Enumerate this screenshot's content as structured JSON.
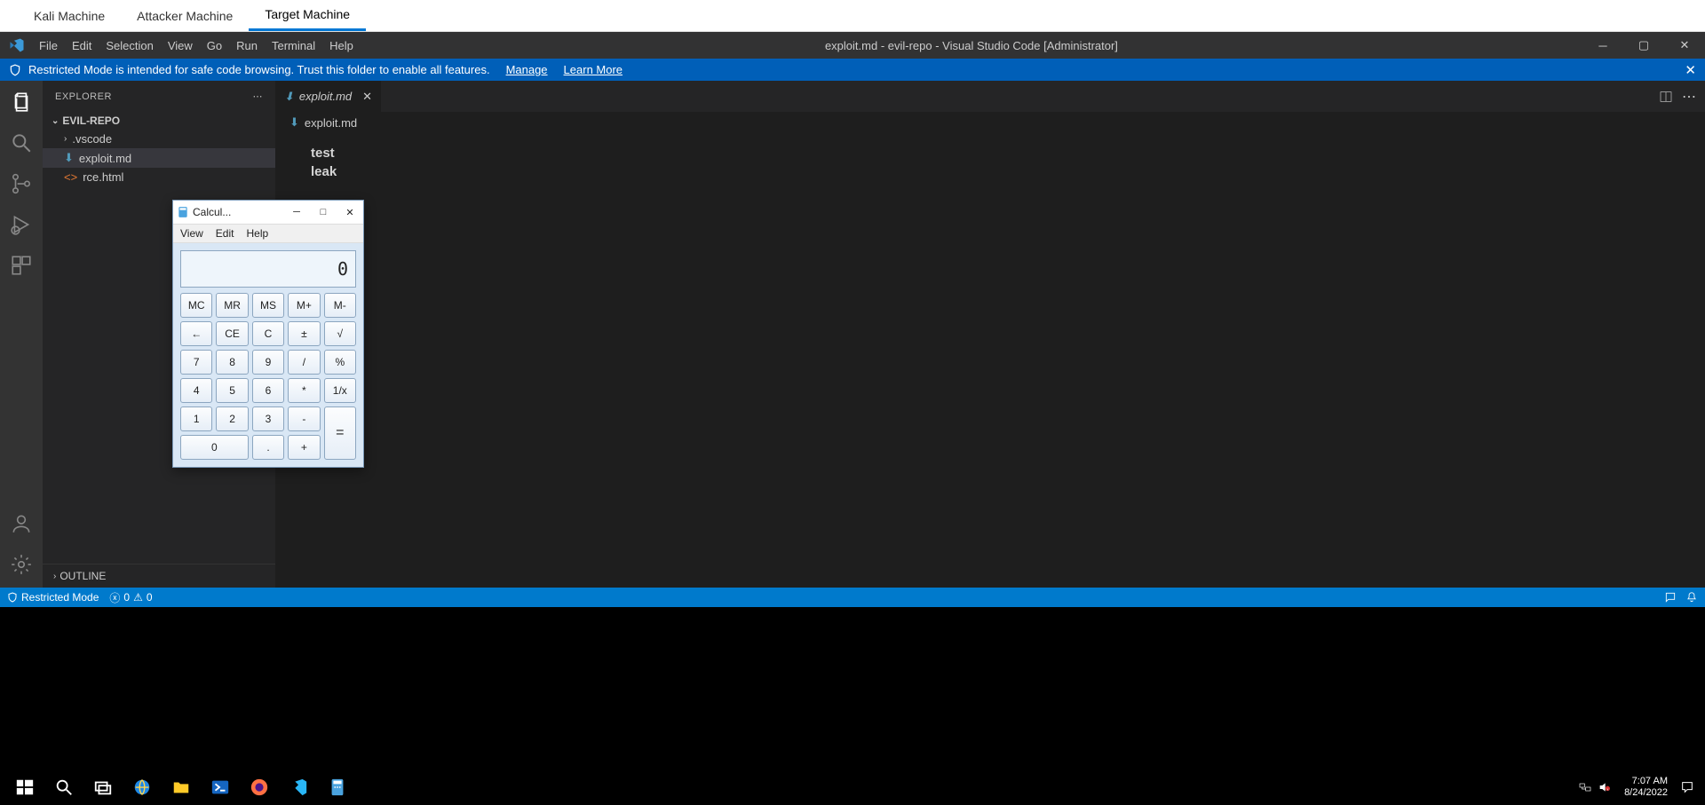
{
  "lab_tabs": {
    "items": [
      "Kali Machine",
      "Attacker Machine",
      "Target Machine"
    ],
    "active_index": 2
  },
  "vscode": {
    "menu": [
      "File",
      "Edit",
      "Selection",
      "View",
      "Go",
      "Run",
      "Terminal",
      "Help"
    ],
    "window_title": "exploit.md - evil-repo - Visual Studio Code [Administrator]",
    "banner": {
      "text": "Restricted Mode is intended for safe code browsing. Trust this folder to enable all features.",
      "manage": "Manage",
      "learn_more": "Learn More"
    },
    "explorer": {
      "title": "EXPLORER",
      "folder": "EVIL-REPO",
      "items": [
        {
          "name": ".vscode",
          "icon": "folder",
          "expanded": false
        },
        {
          "name": "exploit.md",
          "icon": "md",
          "selected": true
        },
        {
          "name": "rce.html",
          "icon": "html"
        }
      ],
      "outline": "OUTLINE"
    },
    "editor": {
      "tab_name": "exploit.md",
      "breadcrumb": "exploit.md",
      "lines": [
        "test",
        "leak"
      ]
    },
    "status": {
      "restricted": "Restricted Mode",
      "errors": "0",
      "warnings": "0"
    }
  },
  "calc": {
    "title": "Calcul...",
    "menu": [
      "View",
      "Edit",
      "Help"
    ],
    "display": "0",
    "rows": {
      "mem": [
        "MC",
        "MR",
        "MS",
        "M+",
        "M-"
      ],
      "clear": [
        "←",
        "CE",
        "C",
        "±",
        "√"
      ],
      "r3": [
        "7",
        "8",
        "9",
        "/",
        "%"
      ],
      "r4": [
        "4",
        "5",
        "6",
        "*",
        "1/x"
      ],
      "r5": [
        "1",
        "2",
        "3",
        "-",
        "="
      ],
      "r6": [
        "0",
        ".",
        "+"
      ]
    }
  },
  "taskbar": {
    "time": "7:07 AM",
    "date": "8/24/2022"
  }
}
